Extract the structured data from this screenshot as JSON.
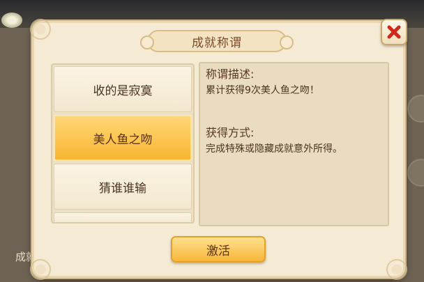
{
  "background": {
    "left_label": "成就"
  },
  "dialog": {
    "title": "成就称谓",
    "close_icon": "close-x-icon",
    "titles_list": [
      {
        "label": "收的是寂寞",
        "selected": false
      },
      {
        "label": "美人鱼之吻",
        "selected": true
      },
      {
        "label": "猜谁谁输",
        "selected": false
      }
    ],
    "info": {
      "description_heading": "称谓描述:",
      "description_text": "累计获得9次美人鱼之吻！",
      "obtain_heading": "获得方式:",
      "obtain_text": "完成特殊或隐藏成就意外所得。"
    },
    "activate_label": "激活"
  },
  "colors": {
    "accent": "#f8b531",
    "close": "#d0281c",
    "text_brown": "#4c3420"
  }
}
